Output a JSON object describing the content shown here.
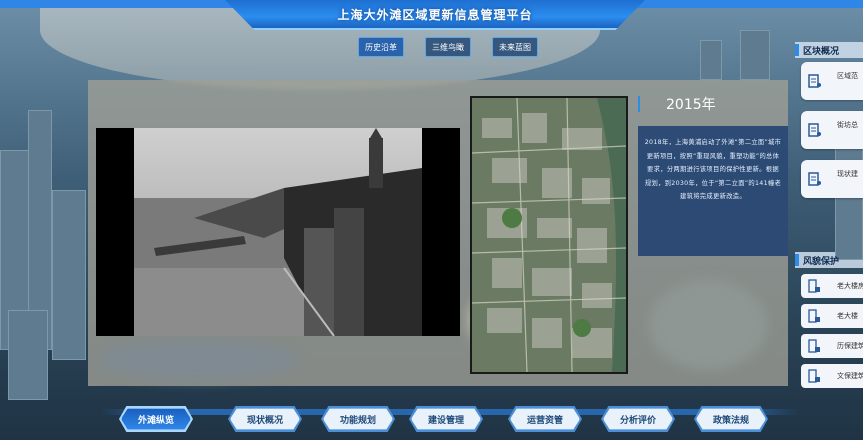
{
  "app": {
    "title": "上海大外滩区域更新信息管理平台"
  },
  "top_tabs": [
    {
      "label": "历史沿革",
      "active": true
    },
    {
      "label": "三维鸟瞰",
      "active": false
    },
    {
      "label": "未来蓝图",
      "active": false
    }
  ],
  "timeline": {
    "year": "2015年",
    "description": "2018年，上海黄浦启动了外滩“第二立面”城市更新项目，按照“重现风貌，重塑功能”的总体要求，分两期进行该项目的保护性更新。根据规划，到2030年，位于“第二立面”的141幢老建筑将完成更新改造。"
  },
  "sidebar": {
    "block_overview": {
      "title": "区块概况",
      "items": [
        {
          "label": "区域范",
          "icon": "building-doc-icon"
        },
        {
          "label": "街坊总",
          "icon": "building-doc-icon"
        },
        {
          "label": "现状建",
          "icon": "building-doc-icon"
        }
      ]
    },
    "heritage": {
      "title": "风貌保护",
      "items": [
        {
          "label": "老大楼房",
          "icon": "building-lock-icon"
        },
        {
          "label": "老大楼",
          "icon": "building-lock-icon"
        },
        {
          "label": "历保建筑",
          "icon": "building-lock-icon"
        },
        {
          "label": "文保建筑",
          "icon": "building-lock-icon"
        }
      ]
    }
  },
  "bottom_nav": [
    {
      "label": "外滩纵览",
      "active": true
    },
    {
      "label": "现状概况",
      "active": false
    },
    {
      "label": "功能规划",
      "active": false
    },
    {
      "label": "建设管理",
      "active": false
    },
    {
      "label": "运营资管",
      "active": false
    },
    {
      "label": "分析评价",
      "active": false
    },
    {
      "label": "政策法规",
      "active": false
    }
  ],
  "colors": {
    "accent": "#2f8ce6",
    "header": "#2b8df0",
    "info_panel": "#193c6e"
  }
}
